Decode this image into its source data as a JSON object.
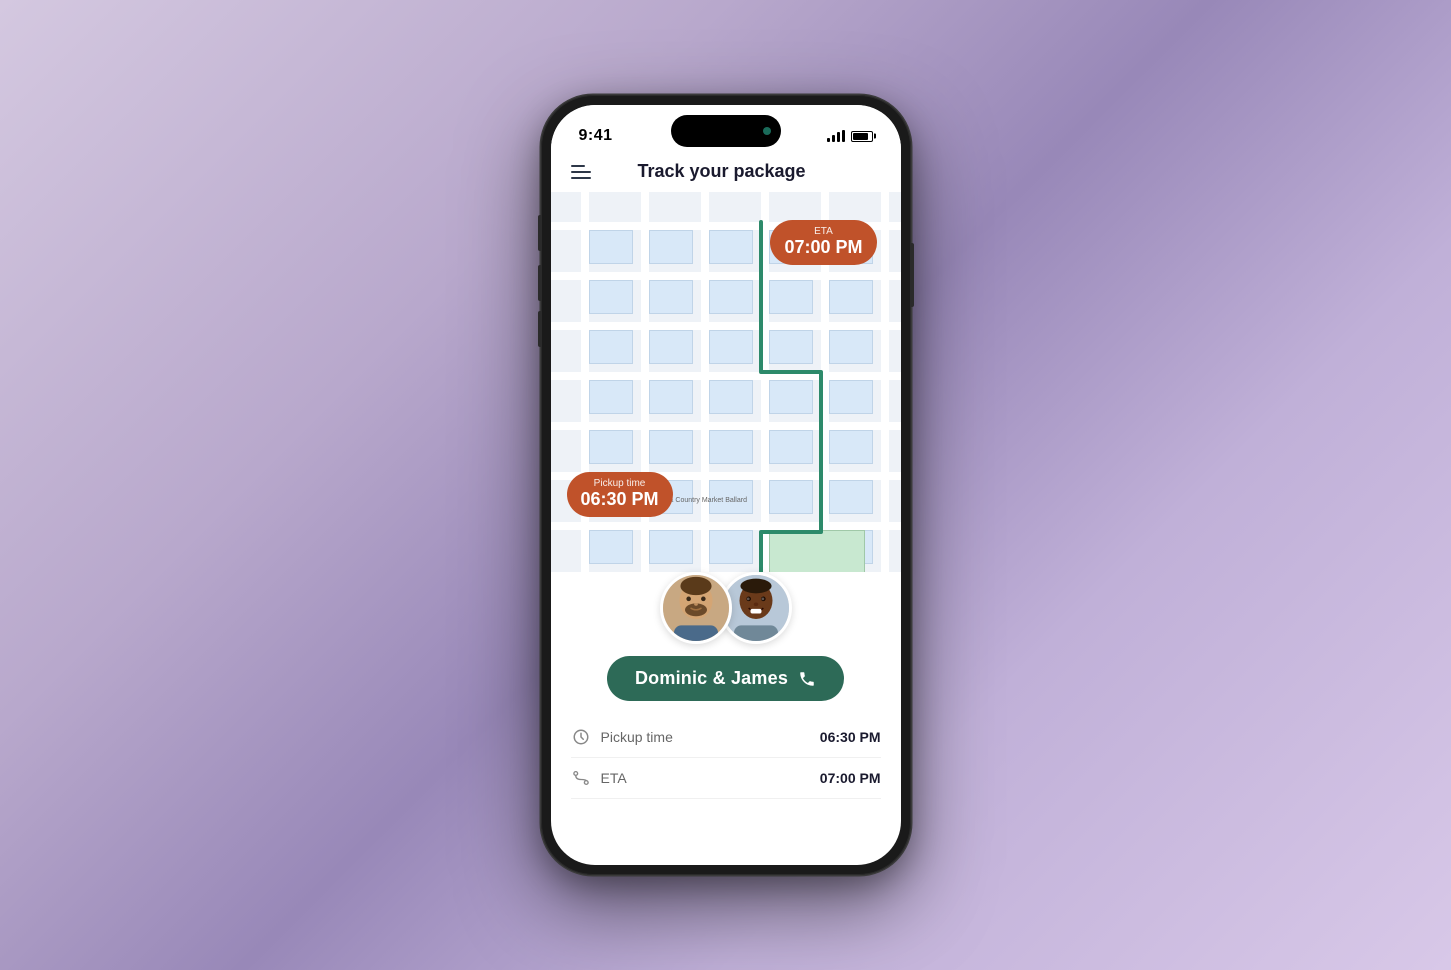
{
  "background": {
    "gradient_start": "#d4c8e0",
    "gradient_end": "#9888b8"
  },
  "status_bar": {
    "time": "9:41",
    "signal_label": "signal-icon",
    "battery_label": "battery-icon"
  },
  "header": {
    "menu_label": "menu-icon",
    "title": "Track your package"
  },
  "map": {
    "eta_label": "ETA",
    "eta_time": "07:00 PM",
    "pickup_label": "Pickup time",
    "pickup_time": "06:30 PM"
  },
  "drivers": {
    "name_button": "Dominic & James",
    "phone_icon": "phone-icon"
  },
  "info_rows": [
    {
      "icon": "clock-icon",
      "label": "Pickup time",
      "value": "06:30 PM"
    },
    {
      "icon": "route-icon",
      "label": "ETA",
      "value": "07:00 PM"
    }
  ]
}
